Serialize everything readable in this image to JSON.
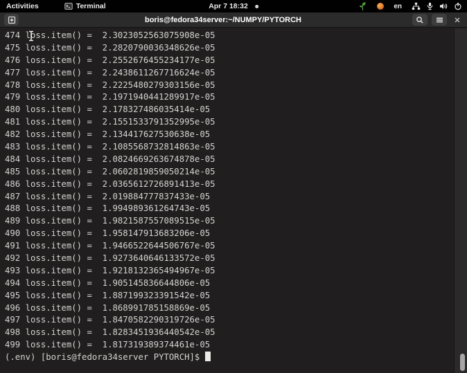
{
  "colors": {
    "topbar_bg": "#010101",
    "titlebar_bg": "#2b2b2b",
    "terminal_bg": "#201e1e",
    "terminal_fg": "#d6d4d1",
    "sprout_green": "#4f9a3e",
    "tray_orange": "#d96f1f",
    "scroll_thumb": "#a9a7a5"
  },
  "top_bar": {
    "activities": "Activities",
    "app_name": "Terminal",
    "clock": "Apr 7 18:32",
    "keyboard_layout": "en"
  },
  "window": {
    "title": "boris@fedora34server:~/NUMPY/PYTORCH"
  },
  "terminal": {
    "lines": [
      "474 loss.item() =  2.3023052563075908e-05",
      "475 loss.item() =  2.2820790036348626e-05",
      "476 loss.item() =  2.2552676455234177e-05",
      "477 loss.item() =  2.2438611267716624e-05",
      "478 loss.item() =  2.2225480279303156e-05",
      "479 loss.item() =  2.1971940441289917e-05",
      "480 loss.item() =  2.178327486035414e-05",
      "481 loss.item() =  2.1551533791352995e-05",
      "482 loss.item() =  2.134417627530638e-05",
      "483 loss.item() =  2.1085568732814863e-05",
      "484 loss.item() =  2.0824669263674878e-05",
      "485 loss.item() =  2.0602819859050214e-05",
      "486 loss.item() =  2.0365612726891413e-05",
      "487 loss.item() =  2.019884777837433e-05",
      "488 loss.item() =  1.994989361264743e-05",
      "489 loss.item() =  1.9821587557089515e-05",
      "490 loss.item() =  1.958147913683206e-05",
      "491 loss.item() =  1.9466522644506767e-05",
      "492 loss.item() =  1.9273640646133572e-05",
      "493 loss.item() =  1.9218132365494967e-05",
      "494 loss.item() =  1.905145836644806e-05",
      "495 loss.item() =  1.887199323391542e-05",
      "496 loss.item() =  1.868991785158869e-05",
      "497 loss.item() =  1.8470582290319726e-05",
      "498 loss.item() =  1.8283451936440542e-05",
      "499 loss.item() =  1.817319389374461e-05"
    ],
    "prompt": "(.env) [boris@fedora34server PYTORCH]$ "
  }
}
